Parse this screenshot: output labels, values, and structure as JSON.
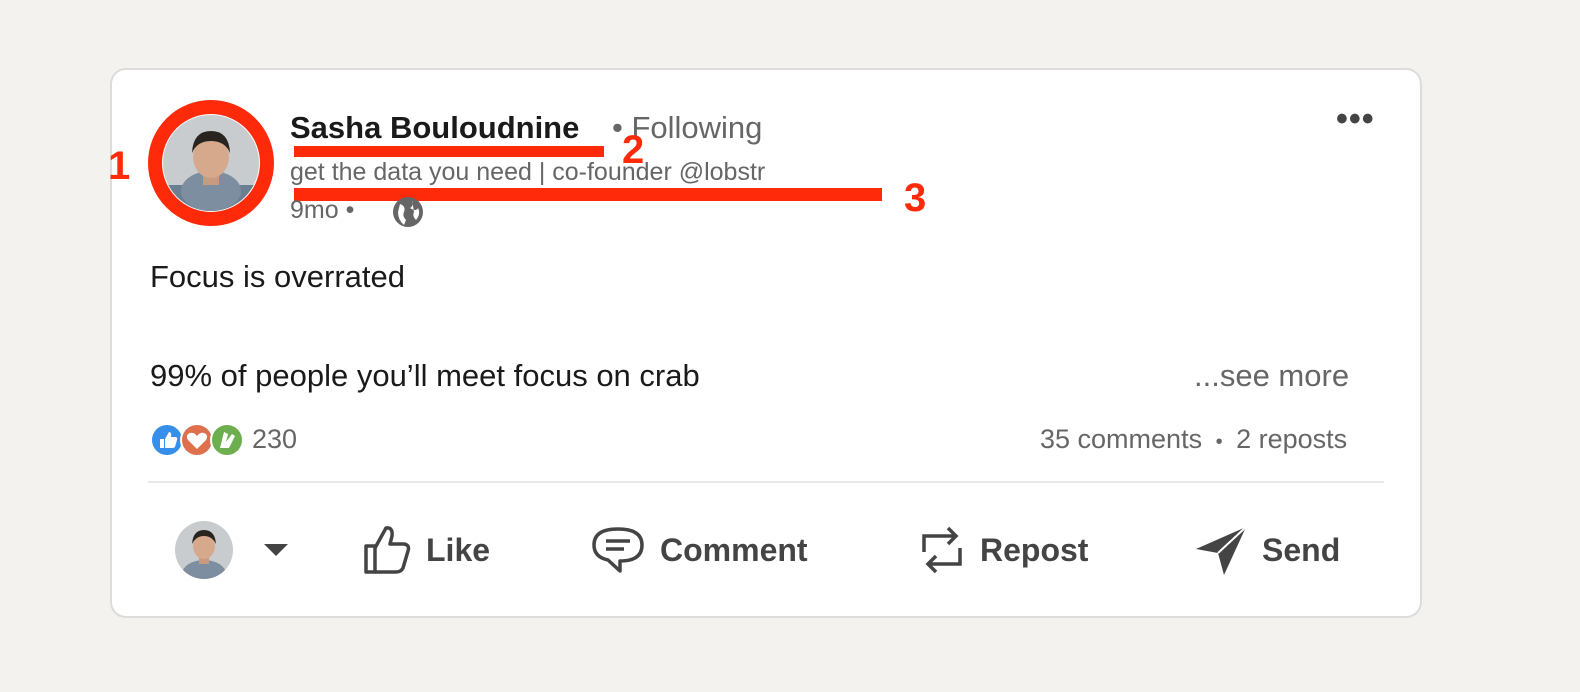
{
  "post": {
    "author_name": "Sasha Bouloudnine",
    "follow_status": "• Following",
    "headline": "get the data you need | co-founder @lobstr",
    "age": "9mo •",
    "text_line1": "Focus is overrated",
    "text_line2": "99% of people you’ll meet focus on crab",
    "see_more": "...see more",
    "reactions_count": "230",
    "comments": "35 comments",
    "separator": "•",
    "reposts": "2 reposts"
  },
  "annotations": {
    "one": "1",
    "two": "2",
    "three": "3"
  },
  "actions": {
    "like": "Like",
    "comment": "Comment",
    "repost": "Repost",
    "send": "Send"
  },
  "colors": {
    "annotation_red": "#ff2a0a",
    "like_blue": "#378fe9",
    "love_red": "#df704d",
    "clap_green": "#6dae4f"
  }
}
